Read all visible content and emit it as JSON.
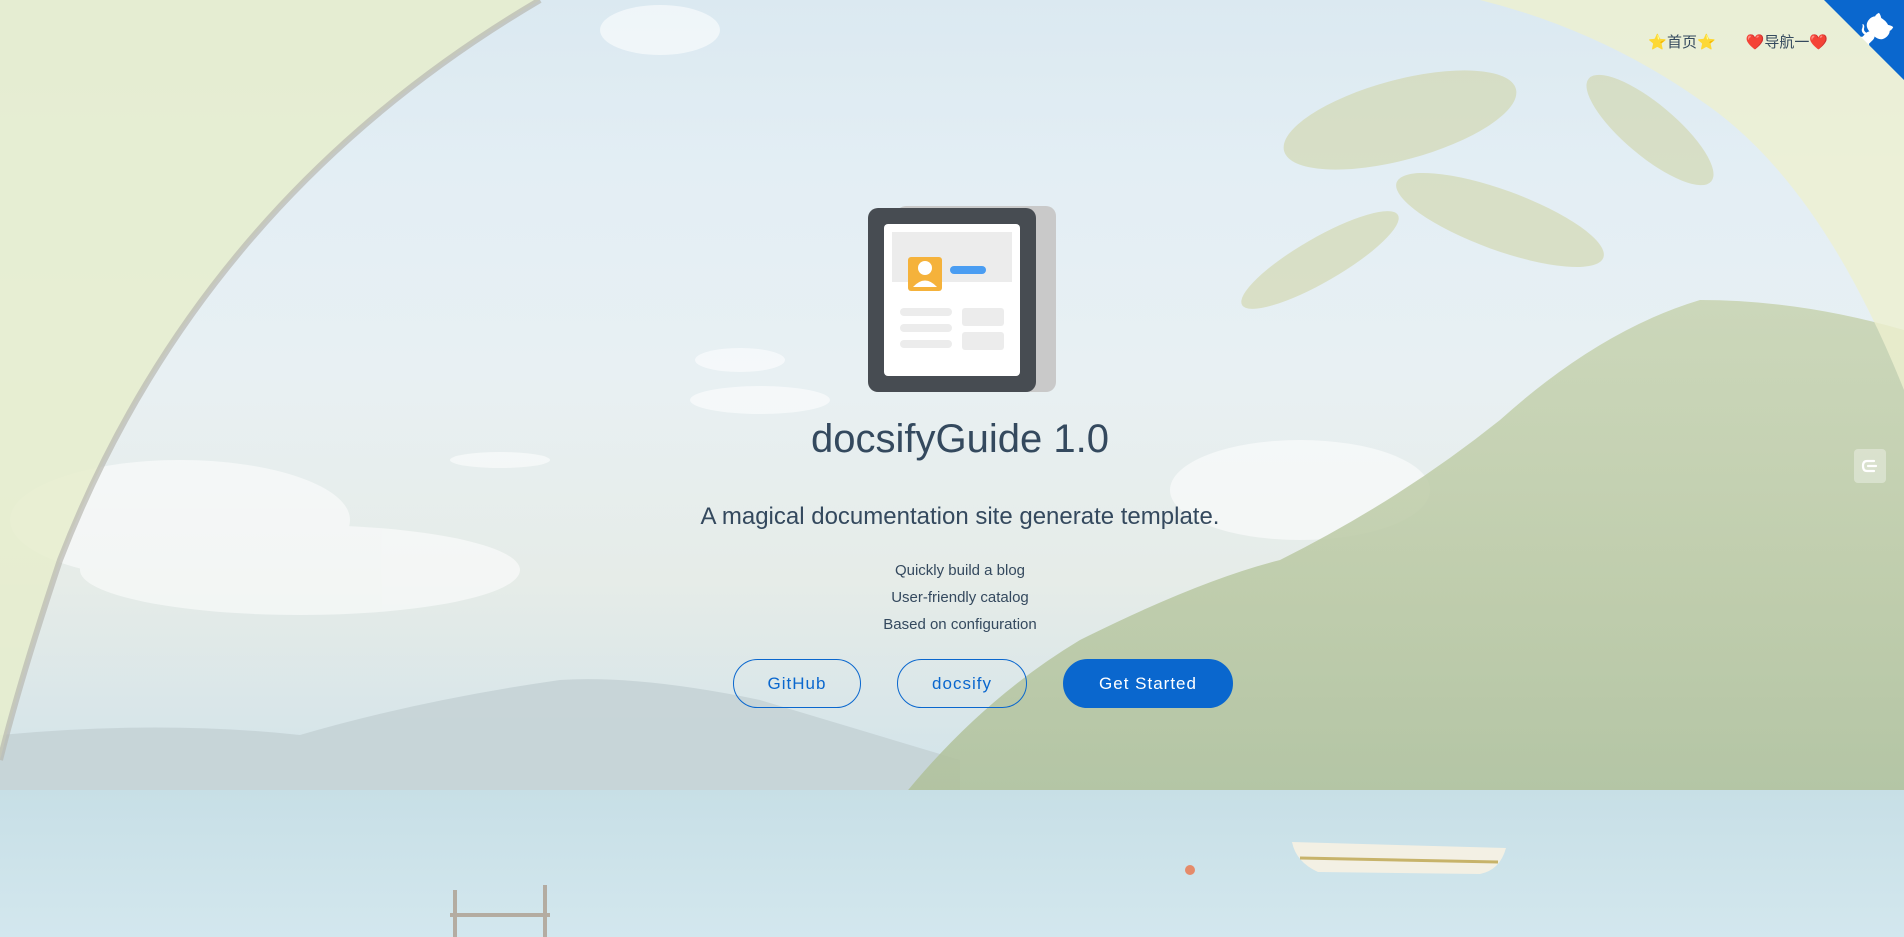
{
  "nav": {
    "items": [
      {
        "label": "⭐首页⭐"
      },
      {
        "label": "❤️导航一❤️"
      }
    ]
  },
  "cover": {
    "title": "docsifyGuide 1.0",
    "subtitle": "A magical documentation site generate template.",
    "features": [
      "Quickly build a blog",
      "User-friendly catalog",
      "Based on configuration"
    ],
    "buttons": {
      "github": "GitHub",
      "docsify": "docsify",
      "get_started": "Get Started"
    }
  },
  "colors": {
    "accent": "#0a67ce",
    "text": "#34495e"
  },
  "icons": {
    "logo": "document-page-icon",
    "corner": "octocat-icon",
    "side": "collapse-sidebar-icon"
  }
}
